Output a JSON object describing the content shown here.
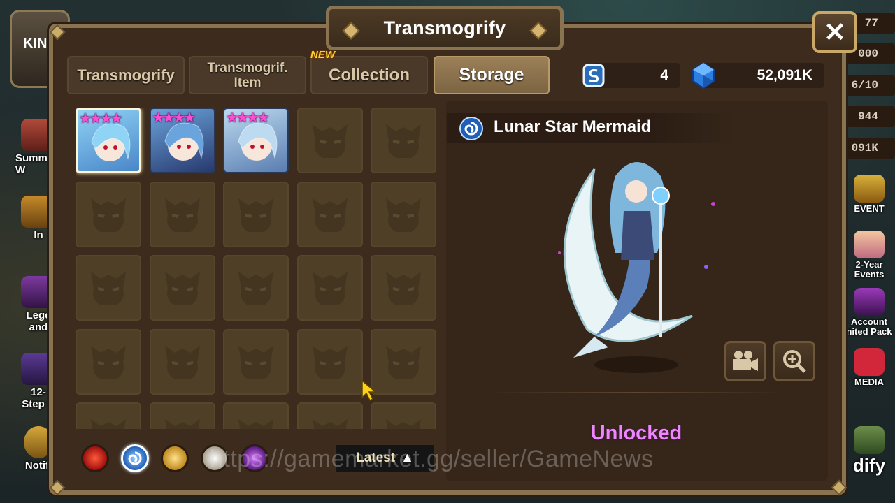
{
  "window": {
    "title": "Transmogrify",
    "close_label": "✕"
  },
  "tabs": [
    {
      "label": "Transmogrify",
      "active": false
    },
    {
      "label": "Transmogrif.\nItem",
      "active": false
    },
    {
      "label": "Collection",
      "active": false,
      "badge": "NEW"
    },
    {
      "label": "Storage",
      "active": true
    }
  ],
  "currency": [
    {
      "icon": "transmog-stone-icon",
      "value": "4"
    },
    {
      "icon": "crystal-icon",
      "value": "52,091K"
    }
  ],
  "storage": {
    "items": [
      {
        "name": "skin-1",
        "stars": 4,
        "selected": true,
        "colors": [
          "#8fd3f5",
          "#4a86c8"
        ]
      },
      {
        "name": "skin-2",
        "stars": 4,
        "selected": false,
        "colors": [
          "#6aa4dc",
          "#28396e"
        ]
      },
      {
        "name": "skin-3",
        "stars": 4,
        "selected": false,
        "colors": [
          "#bcdaf0",
          "#5a7db0"
        ]
      }
    ],
    "total_slots_visible": 25
  },
  "filters": [
    {
      "name": "fire-element-icon",
      "color": "#c02020"
    },
    {
      "name": "water-element-icon",
      "color": "#2f79d6",
      "selected": true
    },
    {
      "name": "wind-element-icon",
      "color": "#d6a030"
    },
    {
      "name": "light-element-icon",
      "color": "#d8d2c4"
    },
    {
      "name": "dark-element-icon",
      "color": "#8a2ab8"
    }
  ],
  "sort": {
    "label": "Latest",
    "arrow": "▲"
  },
  "selected_skin": {
    "name": "Lunar Star Mermaid",
    "status": "Unlocked"
  },
  "watermark": "https://gamemarket.gg/seller/GameNews",
  "background": {
    "left_labels": [
      "KIN",
      "Summ\nW",
      "In",
      "Lege\nand",
      "12-\nStep U",
      "Notifi"
    ],
    "right_stats": [
      "77",
      "000",
      "6/10",
      "944",
      "091K"
    ],
    "right_labels": [
      "EVENT",
      "2-Year\nEvents",
      "Account\nnited Pack",
      "MEDIA",
      "dify"
    ]
  }
}
